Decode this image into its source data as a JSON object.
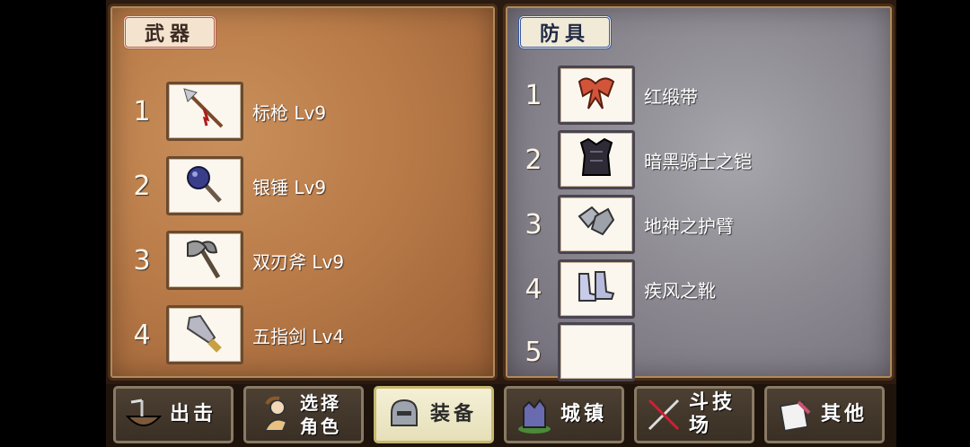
{
  "weapons": {
    "tab_label": "武器",
    "slots": [
      {
        "num": "1",
        "name": "标枪 Lv9",
        "icon": "spear-icon"
      },
      {
        "num": "2",
        "name": "银锤 Lv9",
        "icon": "hammer-icon"
      },
      {
        "num": "3",
        "name": "双刃斧 Lv9",
        "icon": "axe-icon"
      },
      {
        "num": "4",
        "name": "五指剑 Lv4",
        "icon": "sword-icon"
      }
    ]
  },
  "armor": {
    "tab_label": "防具",
    "slots": [
      {
        "num": "1",
        "name": "红缎带",
        "icon": "ribbon-icon"
      },
      {
        "num": "2",
        "name": "暗黑骑士之铠",
        "icon": "dark-armor-icon"
      },
      {
        "num": "3",
        "name": "地神之护臂",
        "icon": "gauntlet-icon"
      },
      {
        "num": "4",
        "name": "疾风之靴",
        "icon": "boots-icon"
      },
      {
        "num": "5",
        "name": "",
        "icon": ""
      }
    ]
  },
  "nav": [
    {
      "label": "出击",
      "icon": "ship-icon",
      "active": false
    },
    {
      "label_line1": "选择",
      "label_line2": "角色",
      "icon": "character-icon",
      "active": false
    },
    {
      "label": "装备",
      "icon": "helmet-icon",
      "active": true
    },
    {
      "label": "城镇",
      "icon": "castle-icon",
      "active": false
    },
    {
      "label": "斗技场",
      "icon": "crossed-swords-icon",
      "active": false
    },
    {
      "label": "其他",
      "icon": "scroll-icon",
      "active": false
    }
  ]
}
